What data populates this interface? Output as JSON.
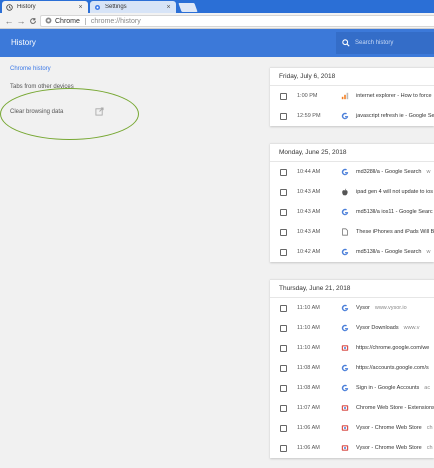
{
  "tabs": [
    {
      "label": "History",
      "icon": "history-icon",
      "active": true
    },
    {
      "label": "Settings",
      "icon": "gear-icon",
      "active": false
    }
  ],
  "toolbar": {
    "site_chip": "Chrome",
    "url": "chrome://history"
  },
  "header": {
    "title": "History",
    "search_placeholder": "Search history"
  },
  "sidebar": {
    "items": [
      {
        "label": "Chrome history",
        "selected": true
      },
      {
        "label": "Tabs from other devices"
      },
      {
        "label": "Clear browsing data"
      }
    ]
  },
  "colors": {
    "tabstrip": "#2b6fd6",
    "header": "#3c79d9",
    "accent": "#3b78e7",
    "highlight": "#78a834"
  },
  "history": [
    {
      "date": "Friday, July 6, 2018",
      "rows": [
        {
          "time": "1:00 PM",
          "icon": "bars-favicon",
          "title": "internet explorer - How to force",
          "domain": ""
        },
        {
          "time": "12:59 PM",
          "icon": "google-g-icon",
          "title": "javascript refresh ie - Google Se",
          "domain": ""
        }
      ]
    },
    {
      "date": "Monday, June 25, 2018",
      "rows": [
        {
          "time": "10:44 AM",
          "icon": "google-g-icon",
          "title": "md328ll/a - Google Search",
          "domain": "w"
        },
        {
          "time": "10:43 AM",
          "icon": "apple-icon",
          "title": "ipad gen 4 will not update to ios",
          "domain": ""
        },
        {
          "time": "10:43 AM",
          "icon": "google-g-icon",
          "title": "md513ll/a ios11 - Google Searc",
          "domain": ""
        },
        {
          "time": "10:43 AM",
          "icon": "document-icon",
          "title": "These iPhones and iPads Will B",
          "domain": ""
        },
        {
          "time": "10:42 AM",
          "icon": "google-g-icon",
          "title": "md513ll/a - Google Search",
          "domain": "w"
        }
      ]
    },
    {
      "date": "Thursday, June 21, 2018",
      "rows": [
        {
          "time": "11:10 AM",
          "icon": "google-g-icon",
          "title": "Vysor",
          "domain": "www.vysor.io"
        },
        {
          "time": "11:10 AM",
          "icon": "google-g-icon",
          "title": "Vysor Downloads",
          "domain": "www.v"
        },
        {
          "time": "11:10 AM",
          "icon": "puzzle-icon",
          "title": "https://chrome.google.com/we",
          "domain": ""
        },
        {
          "time": "11:08 AM",
          "icon": "google-g-icon",
          "title": "https://accounts.google.com/s",
          "domain": ""
        },
        {
          "time": "11:08 AM",
          "icon": "google-g-icon",
          "title": "Sign in - Google Accounts",
          "domain": "ac"
        },
        {
          "time": "11:07 AM",
          "icon": "puzzle-icon",
          "title": "Chrome Web Store - Extensions",
          "domain": ""
        },
        {
          "time": "11:06 AM",
          "icon": "puzzle-icon",
          "title": "Vysor - Chrome Web Store",
          "domain": "ch"
        },
        {
          "time": "11:06 AM",
          "icon": "puzzle-icon",
          "title": "Vysor - Chrome Web Store",
          "domain": "ch"
        }
      ]
    }
  ]
}
